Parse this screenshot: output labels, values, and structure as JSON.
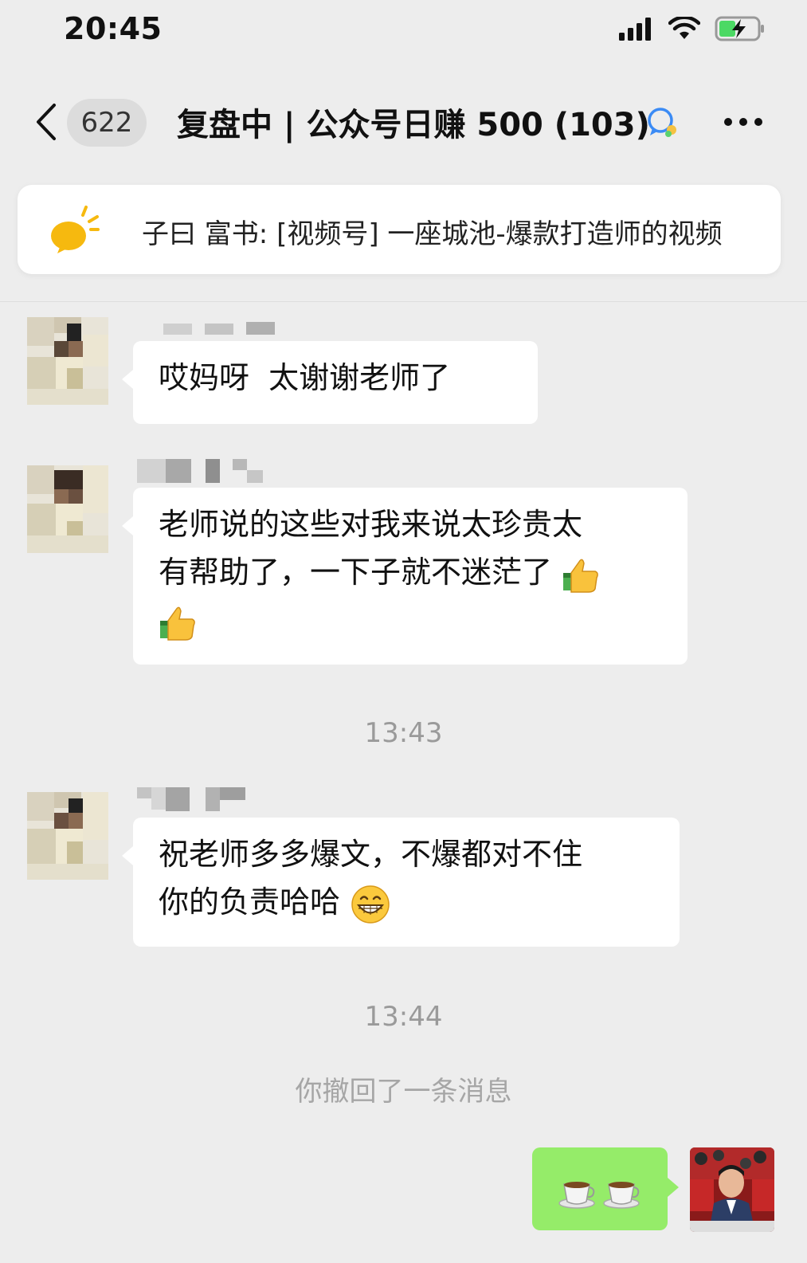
{
  "status_bar": {
    "time": "20:45"
  },
  "nav": {
    "unread_count": "622",
    "title": "复盘中 | 公众号日赚 500 (103)"
  },
  "notice": {
    "text": "子曰 富书: [视频号] 一座城池-爆款打造师的视频"
  },
  "messages": [
    {
      "text": "哎妈呀  太谢谢老师了"
    },
    {
      "text_line1": "老师说的这些对我来说太珍贵太",
      "text_line2": "有帮助了，一下子就不迷茫了"
    },
    {
      "text_line1": "祝老师多多爆文，不爆都对不住",
      "text_line2": "你的负责哈哈"
    }
  ],
  "timestamps": [
    "13:43",
    "13:44"
  ],
  "recall_notice": "你撤回了一条消息",
  "colors": {
    "background": "#ededed",
    "bubble_other": "#ffffff",
    "bubble_self": "#95ec69",
    "timestamp": "#9a9a9a"
  },
  "icons": [
    "back-chevron-icon",
    "group-chat-icon",
    "more-dots-icon",
    "megaphone-icon",
    "thumbs-up-emoji",
    "grin-emoji",
    "coffee-emoji"
  ]
}
